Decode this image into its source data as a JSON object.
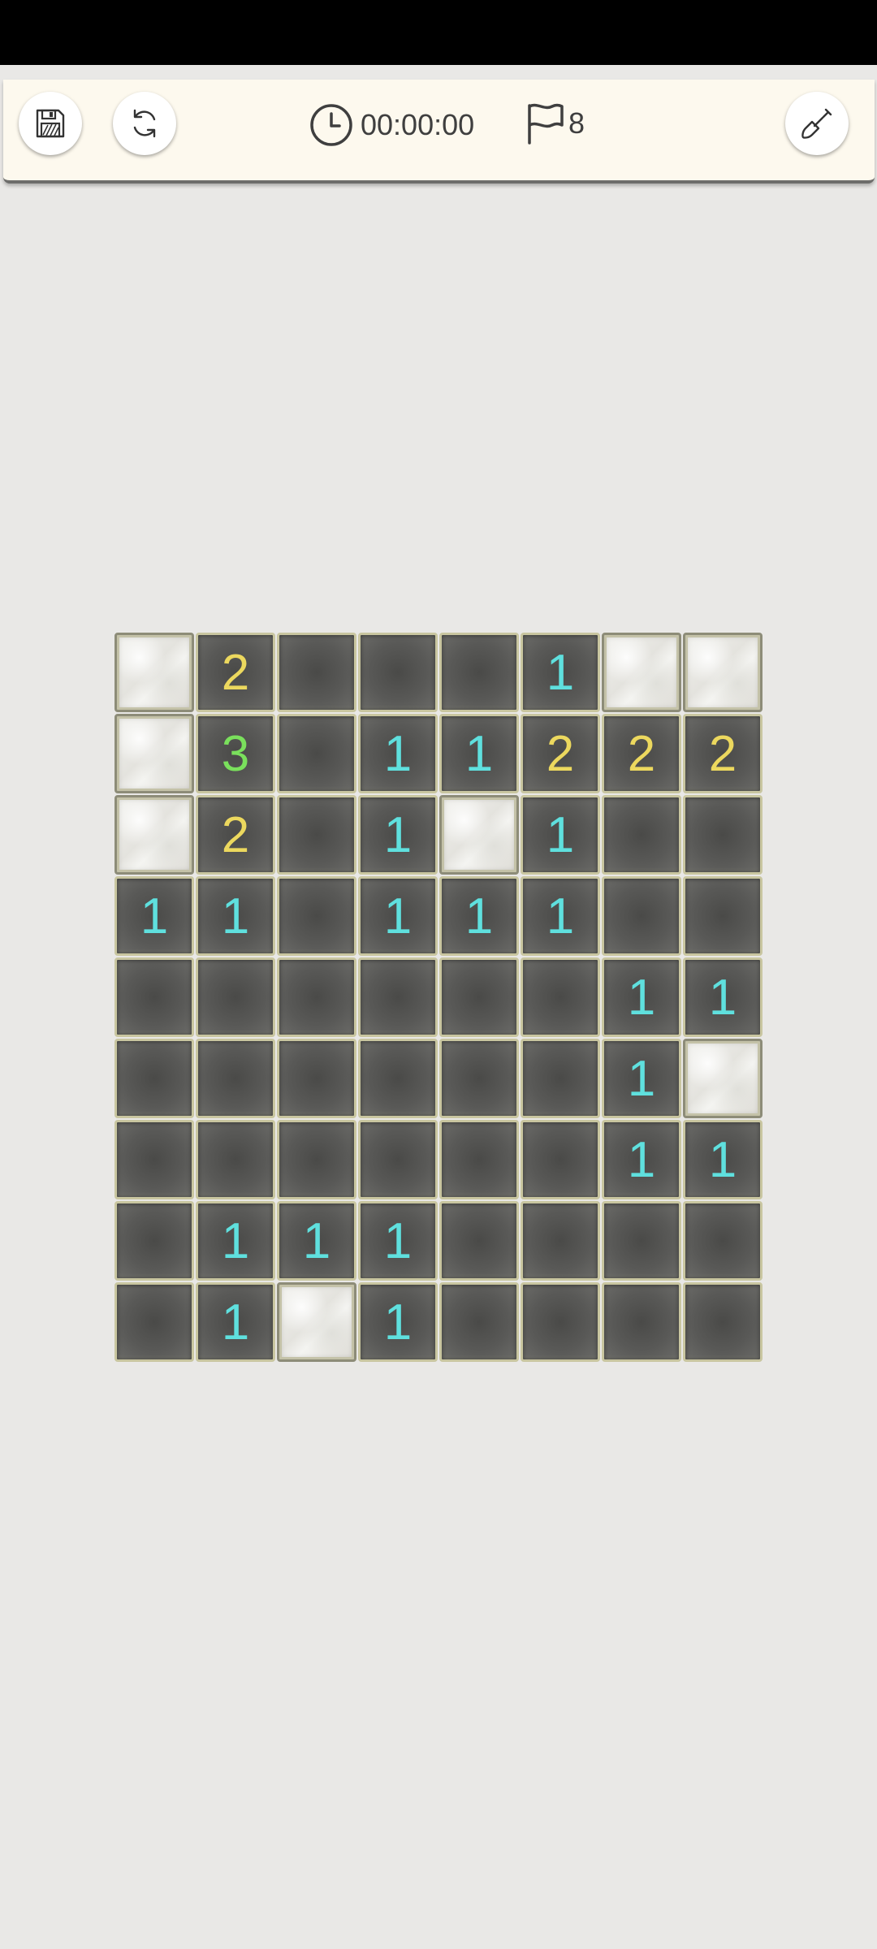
{
  "app": {
    "timer": "00:00:00",
    "flags_remaining": "8"
  },
  "toolbar": {
    "save_icon": "save-icon",
    "restart_icon": "restart-icon",
    "tool_icon": "shovel-icon"
  },
  "colors": {
    "number_1": "#5fe0de",
    "number_2": "#ecd85e",
    "number_3": "#7ae05c",
    "toolbar_bg": "#fdf9ee",
    "page_bg": "#e9e8e6"
  },
  "board": {
    "rows": 9,
    "cols": 8,
    "grid": [
      [
        "#",
        "2",
        ".",
        ".",
        ".",
        "1",
        "#",
        "#"
      ],
      [
        "#",
        "3",
        ".",
        "1",
        "1",
        "2",
        "2",
        "2"
      ],
      [
        "#",
        "2",
        ".",
        "1",
        "#",
        "1",
        ".",
        "."
      ],
      [
        "1",
        "1",
        ".",
        "1",
        "1",
        "1",
        ".",
        "."
      ],
      [
        ".",
        ".",
        ".",
        ".",
        ".",
        ".",
        "1",
        "1"
      ],
      [
        ".",
        ".",
        ".",
        ".",
        ".",
        ".",
        "1",
        "#"
      ],
      [
        ".",
        ".",
        ".",
        ".",
        ".",
        ".",
        "1",
        "1"
      ],
      [
        ".",
        "1",
        "1",
        "1",
        ".",
        ".",
        ".",
        "."
      ],
      [
        ".",
        "1",
        "#",
        "1",
        ".",
        ".",
        ".",
        "."
      ]
    ]
  }
}
